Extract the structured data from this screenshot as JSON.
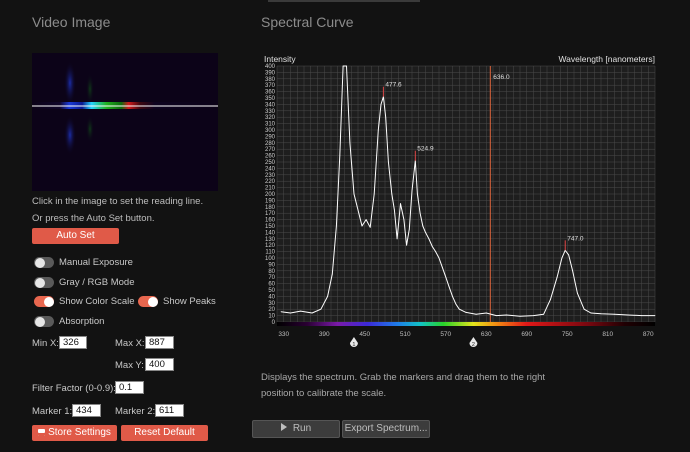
{
  "left": {
    "title": "Video Image",
    "hint_line1": "Click in the image to set the reading line.",
    "hint_line2": "Or press the Auto Set button.",
    "auto_set_label": "Auto Set",
    "toggles": [
      {
        "label": "Manual Exposure",
        "on": false
      },
      {
        "label": "Gray / RGB Mode",
        "on": false
      },
      {
        "label": "Show Color Scale",
        "on": true
      },
      {
        "label": "Show Peaks",
        "on": true
      },
      {
        "label": "Absorption",
        "on": false
      }
    ],
    "min_x_label": "Min X:",
    "min_x_value": "326",
    "max_x_label": "Max X:",
    "max_x_value": "887",
    "max_y_label": "Max Y:",
    "max_y_value": "400",
    "filter_label": "Filter Factor (0-0.9):",
    "filter_value": "0.1",
    "marker1_label": "Marker 1:",
    "marker1_value": "434",
    "marker2_label": "Marker 2:",
    "marker2_value": "611",
    "store_label": "Store Settings",
    "reset_label": "Reset Default"
  },
  "right": {
    "title": "Spectral Curve",
    "description_line1": "Displays the spectrum. Grab the markers and drag them to the right",
    "description_line2": "position to calibrate the scale.",
    "run_label": "Run",
    "export_label": "Export Spectrum..."
  },
  "colors": {
    "accent": "#e05a48",
    "background": "#121212",
    "plot_background": "#1e1e1e",
    "grid": "#4a4a4a",
    "curve": "#ffffff",
    "cursor_line": "#e0663c",
    "peak_marker": "#e04646"
  },
  "chart_data": {
    "type": "line",
    "title": "",
    "ylabel": "Intensity",
    "xlabel": "Wavelength [nanometers]",
    "xlim": [
      320,
      880
    ],
    "ylim": [
      0,
      400
    ],
    "y_ticks": [
      0,
      10,
      20,
      30,
      40,
      50,
      60,
      70,
      80,
      90,
      100,
      110,
      120,
      130,
      140,
      150,
      160,
      170,
      180,
      190,
      200,
      210,
      220,
      230,
      240,
      250,
      260,
      270,
      280,
      290,
      300,
      310,
      320,
      330,
      340,
      350,
      360,
      370,
      380,
      390,
      400
    ],
    "x_tick_labels": [
      "330",
      "390",
      "450",
      "510",
      "570",
      "630",
      "690",
      "750",
      "810",
      "870"
    ],
    "x_ticks": [
      330,
      390,
      450,
      510,
      570,
      630,
      690,
      750,
      810,
      870
    ],
    "cursor": {
      "value": 636.0,
      "label": "636.0"
    },
    "peaks": [
      {
        "x": 477.6,
        "y": 352,
        "label": "477.6"
      },
      {
        "x": 524.9,
        "y": 252,
        "label": "524.9"
      },
      {
        "x": 747.0,
        "y": 112,
        "label": "747.0"
      }
    ],
    "markers": [
      {
        "value": 434,
        "label": "1"
      },
      {
        "value": 611,
        "label": "2"
      }
    ],
    "series": [
      {
        "x": [
          326,
          340,
          355,
          372,
          385,
          395,
          402,
          408,
          413,
          418,
          423,
          428,
          434,
          440,
          446,
          452,
          458,
          464,
          470,
          474,
          477.6,
          481,
          485,
          490,
          494,
          498,
          503,
          508,
          512,
          516,
          520,
          524.9,
          528,
          532,
          536,
          540,
          545,
          550,
          555,
          560,
          565,
          570,
          575,
          580,
          585,
          590,
          600,
          615,
          630,
          645,
          660,
          680,
          700,
          715,
          725,
          735,
          742,
          747,
          752,
          758,
          765,
          775,
          785,
          800,
          820,
          840,
          860,
          880
        ],
        "y": [
          16,
          14,
          17,
          14,
          20,
          40,
          75,
          150,
          260,
          400,
          400,
          280,
          200,
          175,
          150,
          160,
          148,
          200,
          300,
          340,
          352,
          320,
          250,
          200,
          175,
          130,
          185,
          160,
          120,
          145,
          205,
          252,
          200,
          170,
          150,
          140,
          130,
          118,
          110,
          100,
          85,
          70,
          55,
          40,
          28,
          20,
          15,
          12,
          14,
          10,
          11,
          9,
          10,
          12,
          35,
          70,
          100,
          112,
          105,
          80,
          45,
          20,
          14,
          13,
          12,
          11,
          10,
          10
        ]
      }
    ]
  }
}
